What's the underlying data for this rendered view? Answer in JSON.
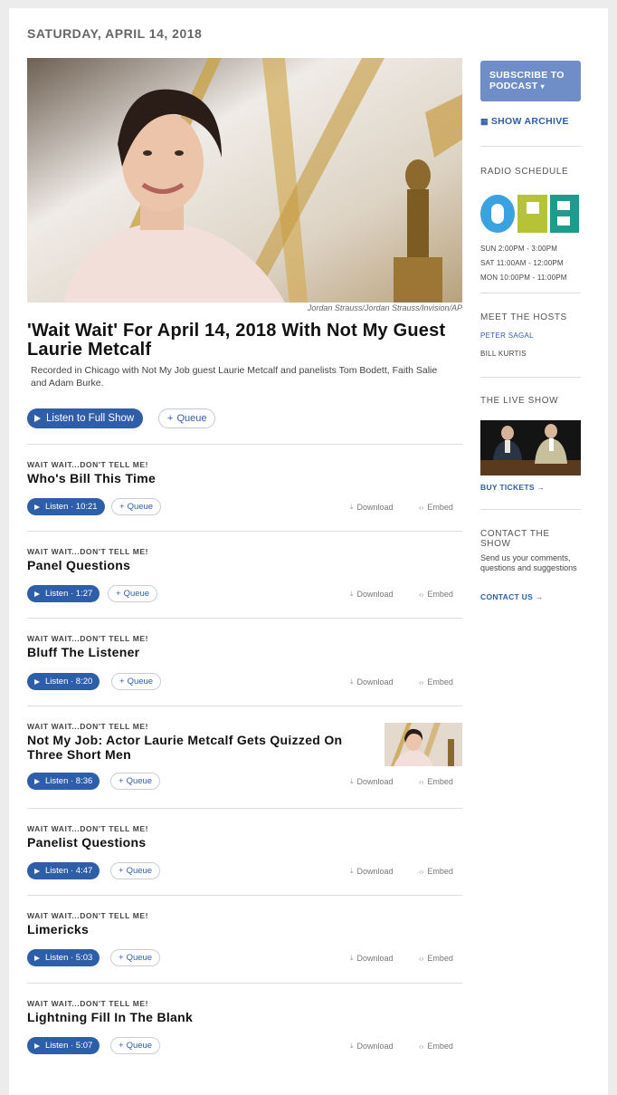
{
  "date": "SATURDAY, APRIL 14, 2018",
  "hero": {
    "credit": "Jordan Strauss/Jordan Strauss/Invision/AP"
  },
  "show": {
    "title": "'Wait Wait' For April 14, 2018 With Not My Guest Laurie Metcalf",
    "description": "Recorded in Chicago with Not My Job guest Laurie Metcalf and panelists Tom Bodett, Faith Salie and Adam Burke.",
    "listen_label": "Listen to Full Show",
    "queue_label": "Queue"
  },
  "segments": [
    {
      "kicker": "WAIT WAIT...DON'T TELL ME!",
      "title": "Who's Bill This Time",
      "listen": "Listen · 10:21",
      "queue": "Queue",
      "download": "Download",
      "embed": "Embed"
    },
    {
      "kicker": "WAIT WAIT...DON'T TELL ME!",
      "title": "Panel Questions",
      "listen": "Listen · 1:27",
      "queue": "Queue",
      "download": "Download",
      "embed": "Embed"
    },
    {
      "kicker": "WAIT WAIT...DON'T TELL ME!",
      "title": "Bluff The Listener",
      "listen": "Listen · 8:20",
      "queue": "Queue",
      "download": "Download",
      "embed": "Embed"
    },
    {
      "kicker": "WAIT WAIT...DON'T TELL ME!",
      "title": "Not My Job: Actor Laurie Metcalf Gets Quizzed On Three Short Men",
      "listen": "Listen · 8:36",
      "queue": "Queue",
      "download": "Download",
      "embed": "Embed"
    },
    {
      "kicker": "WAIT WAIT...DON'T TELL ME!",
      "title": "Panelist Questions",
      "listen": "Listen · 4:47",
      "queue": "Queue",
      "download": "Download",
      "embed": "Embed"
    },
    {
      "kicker": "WAIT WAIT...DON'T TELL ME!",
      "title": "Limericks",
      "listen": "Listen · 5:03",
      "queue": "Queue",
      "download": "Download",
      "embed": "Embed"
    },
    {
      "kicker": "WAIT WAIT...DON'T TELL ME!",
      "title": "Lightning Fill In The Blank",
      "listen": "Listen · 5:07",
      "queue": "Queue",
      "download": "Download",
      "embed": "Embed"
    }
  ],
  "sidebar": {
    "subscribe_label": "SUBSCRIBE TO PODCAST",
    "archive_label": "SHOW ARCHIVE",
    "radio_schedule_heading": "RADIO SCHEDULE",
    "schedule": [
      "SUN 2:00PM - 3:00PM",
      "SAT 11:00AM - 12:00PM",
      "MON 10:00PM - 11:00PM"
    ],
    "hosts_heading": "MEET THE HOSTS",
    "hosts": [
      "PETER SAGAL",
      "BILL KURTIS"
    ],
    "live_heading": "THE LIVE SHOW",
    "buy_tickets": "BUY TICKETS →",
    "contact_heading": "CONTACT THE SHOW",
    "contact_text": "Send us your comments, questions and suggestions",
    "contact_link": "CONTACT US →"
  },
  "colors": {
    "accent": "#2f5ea8",
    "subscribe_bg": "#6f8ec7"
  }
}
